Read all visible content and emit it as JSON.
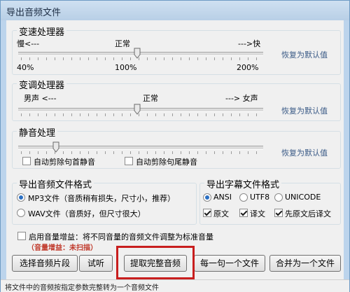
{
  "window": {
    "title": "导出音频文件"
  },
  "speed": {
    "title": "变速处理器",
    "label_left": "慢<---",
    "label_mid": "正常",
    "label_right": "--->快",
    "value_left": "40%",
    "value_mid": "100%",
    "value_right": "200%",
    "level": 0.5,
    "reset": "恢复为默认值"
  },
  "pitch": {
    "title": "变调处理器",
    "label_left": "男声 <---",
    "label_mid": "正常",
    "label_right": "---> 女声",
    "level": 0.5,
    "reset": "恢复为默认值"
  },
  "silence": {
    "title": "静音处理",
    "level": 0.16,
    "reset": "恢复为默认值",
    "opt_head": "自动剪除句首静音",
    "opt_tail": "自动剪除句尾静音",
    "opt_head_checked": false,
    "opt_tail_checked": false
  },
  "audio_format": {
    "title": "导出音频文件格式",
    "mp3": "MP3文件（音质稍有损失，尺寸小，推荐）",
    "wav": "WAV文件（音质好，但尺寸很大）",
    "selected": "mp3"
  },
  "subtitle_format": {
    "title": "导出字幕文件格式",
    "enc_ansi": "ANSI",
    "enc_utf8": "UTF8",
    "enc_unicode": "UNICODE",
    "selected_encoding": "ANSI",
    "opt_original": "原文",
    "opt_translation": "译文",
    "opt_both": "先原文后译文",
    "original_checked": true,
    "translation_checked": true,
    "both_checked": true
  },
  "gain": {
    "label": "启用音量增益：将不同音量的音频文件调整为标准音量",
    "status": "（音量增益：未扫描）",
    "checked": false,
    "status_color": "#c0392b"
  },
  "buttons": {
    "select_segment": "选择音频片段",
    "preview": "试听",
    "extract_full": "提取完整音频",
    "per_sentence": "每一句一个文件",
    "merge_one": "合并为一个文件"
  },
  "status": "将文件中的音频按指定参数完整转为一个音频文件",
  "colors": {
    "highlight": "#c81e1e",
    "titlebar": "#bcd4ec",
    "link": "#3a5a86"
  }
}
